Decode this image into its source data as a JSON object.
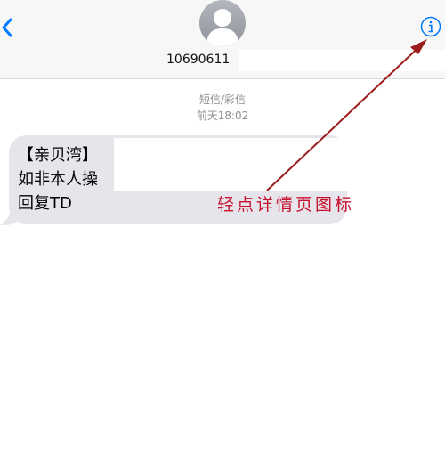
{
  "header": {
    "contact_number": "10690611",
    "back_icon": "chevron-left-icon",
    "info_icon": "info-icon",
    "avatar_icon": "person-silhouette-icon"
  },
  "thread": {
    "message_type": "短信/彩信",
    "timestamp": "前天18:02"
  },
  "message": {
    "lines": [
      "【亲贝湾】",
      "如非本人操",
      "回复TD"
    ]
  },
  "annotation": {
    "text": "轻点详情页图标",
    "color": "#c8102e"
  },
  "colors": {
    "accent": "#007aff",
    "bubble": "#e6e5eb",
    "secondary_text": "#8e8e93"
  }
}
